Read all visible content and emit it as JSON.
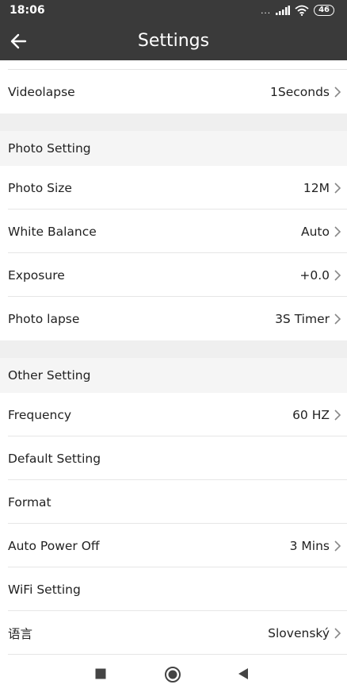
{
  "status": {
    "time": "18:06",
    "dots": "...",
    "battery": "46"
  },
  "header": {
    "title": "Settings"
  },
  "top_items": [
    {
      "label": "Videolapse",
      "value": "1Seconds"
    }
  ],
  "photo_section": {
    "title": "Photo Setting",
    "items": [
      {
        "label": "Photo Size",
        "value": "12M"
      },
      {
        "label": "White Balance",
        "value": "Auto"
      },
      {
        "label": "Exposure",
        "value": "+0.0"
      },
      {
        "label": "Photo lapse",
        "value": "3S Timer"
      }
    ]
  },
  "other_section": {
    "title": "Other Setting",
    "items": [
      {
        "label": "Frequency",
        "value": "60 HZ"
      },
      {
        "label": "Default Setting",
        "value": ""
      },
      {
        "label": "Format",
        "value": ""
      },
      {
        "label": "Auto Power Off",
        "value": "3 Mins"
      },
      {
        "label": "WiFi Setting",
        "value": ""
      },
      {
        "label": "语言",
        "value": "Slovenský"
      }
    ]
  },
  "icons": {
    "back": "arrow-left-icon",
    "chevron": "chevron-right-icon",
    "nav": [
      "square-icon",
      "circle-icon",
      "triangle-left-icon"
    ]
  },
  "colors": {
    "app_bar": "#3a3a3a",
    "section_bg": "#f5f5f5",
    "divider": "#e6e6e6"
  }
}
